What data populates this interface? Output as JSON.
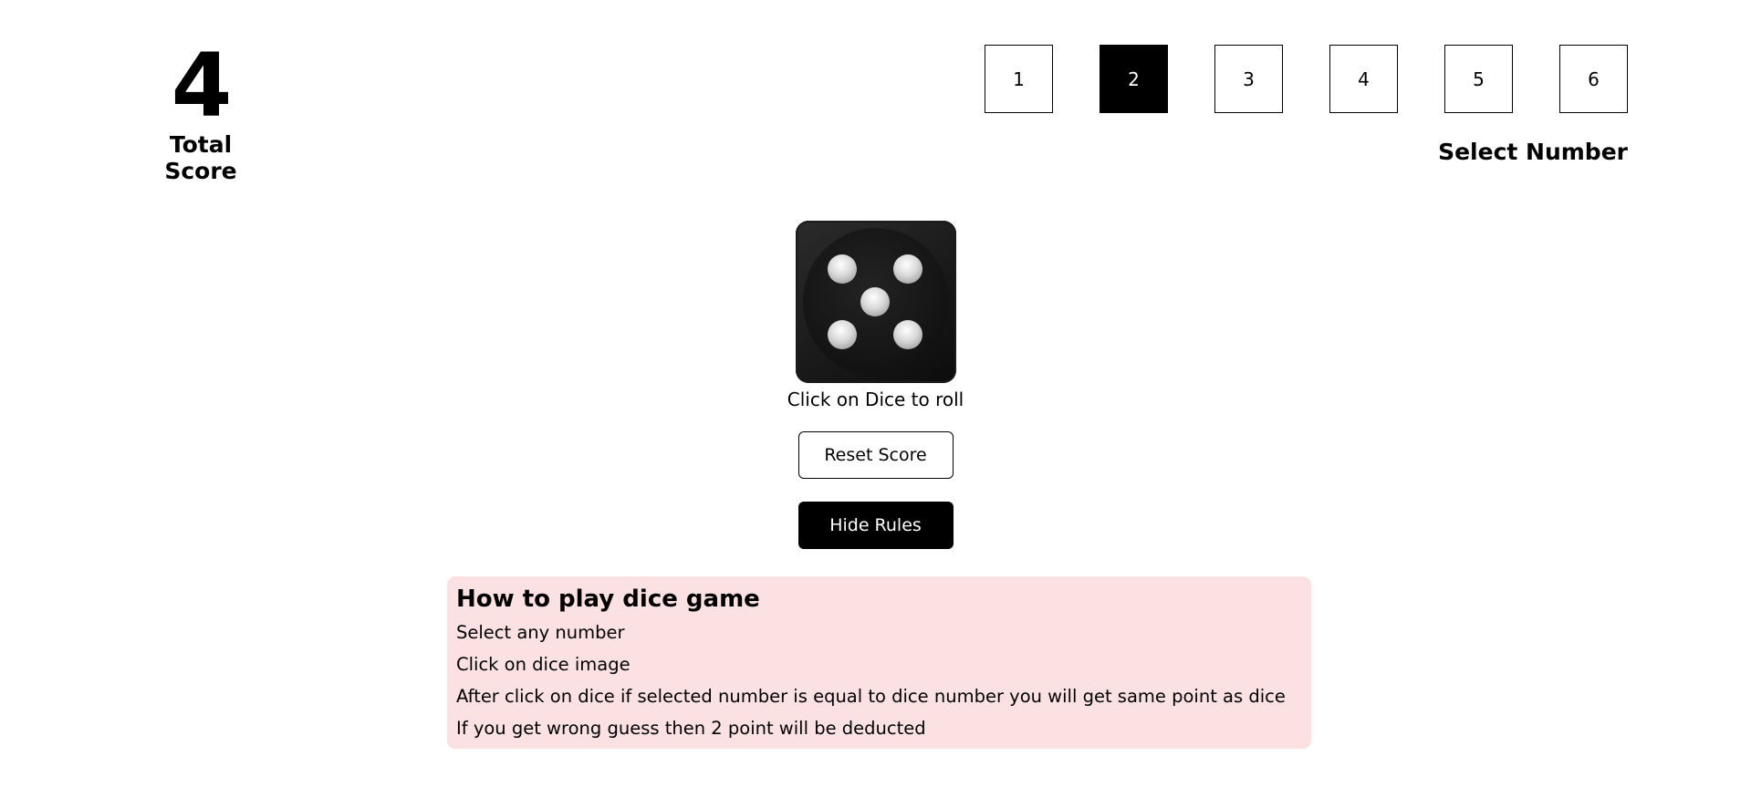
{
  "score": {
    "value": "4",
    "label": "Total Score"
  },
  "number_selector": {
    "numbers": [
      "1",
      "2",
      "3",
      "4",
      "5",
      "6"
    ],
    "selected": "2",
    "label": "Select Number"
  },
  "dice": {
    "face_value": 5,
    "hint": "Click on Dice to roll"
  },
  "buttons": {
    "reset_label": "Reset Score",
    "rules_toggle_label": "Hide Rules"
  },
  "rules": {
    "title": "How to play dice game",
    "lines": [
      "Select any number",
      "Click on dice image",
      "After click on dice if selected number is equal to dice number you will get same point as dice",
      "If you get wrong guess then 2 point will be deducted"
    ],
    "background_color": "#fbe1e1"
  },
  "colors": {
    "selected_box": "#000000",
    "primary_button": "#000000"
  }
}
